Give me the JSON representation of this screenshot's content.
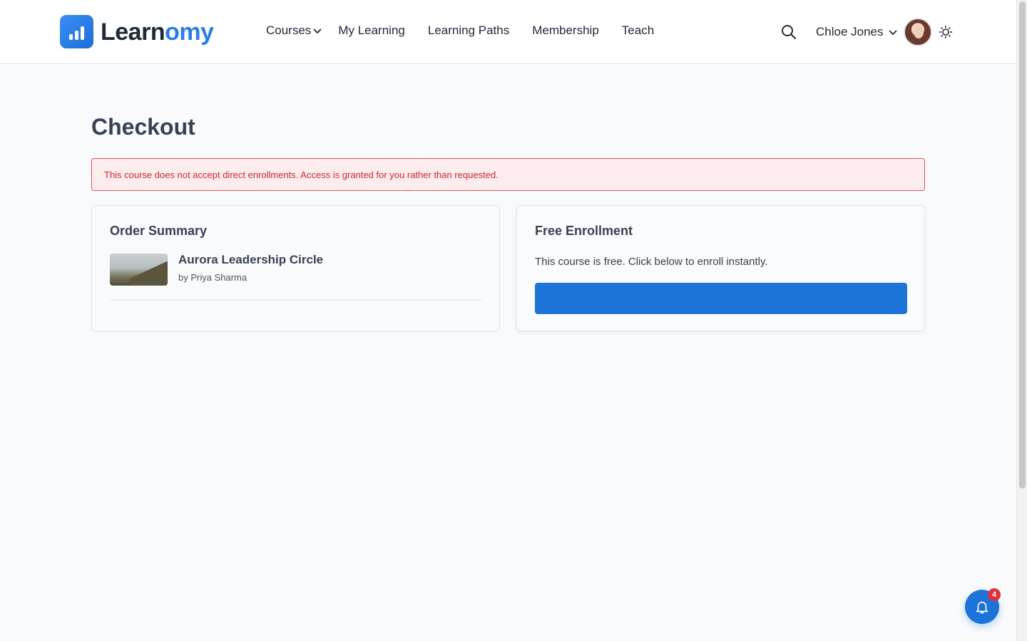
{
  "brand": {
    "name_part1": "Learn",
    "name_part2": "omy",
    "accent": "#2a7de1"
  },
  "nav": {
    "items": [
      {
        "label": "Courses",
        "has_dropdown": true
      },
      {
        "label": "My Learning"
      },
      {
        "label": "Learning Paths"
      },
      {
        "label": "Membership"
      },
      {
        "label": "Teach"
      }
    ]
  },
  "header": {
    "search_icon": "search-icon",
    "user_name": "Chloe Jones",
    "theme_icon": "sun-icon"
  },
  "page": {
    "title": "Checkout",
    "alert": "This course does not accept direct enrollments. Access is granted for you rather than requested.",
    "alert_color": "#c62834"
  },
  "order_summary": {
    "title": "Order Summary",
    "course_name": "Aurora Leadership Circle",
    "course_author": "by Priya Sharma"
  },
  "free_enrollment": {
    "title": "Free Enrollment",
    "text": "This course is free. Click below to enroll instantly.",
    "button_color": "#1c74d9"
  },
  "notifications": {
    "count": "4",
    "icon": "bell-icon"
  }
}
